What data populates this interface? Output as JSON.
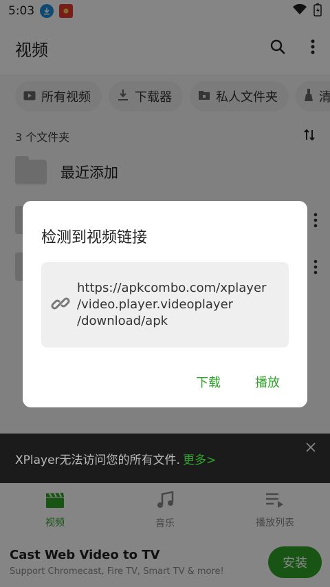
{
  "status_bar": {
    "time": "5:03",
    "icons": [
      "download-notification-icon",
      "app-notification-icon",
      "wifi-icon",
      "battery-charging-icon"
    ]
  },
  "app_bar": {
    "title": "视频",
    "actions": [
      "search-icon",
      "more-vert-icon"
    ]
  },
  "chips": [
    {
      "label": "所有视频",
      "icon": "video-icon"
    },
    {
      "label": "下载器",
      "icon": "download-icon"
    },
    {
      "label": "私人文件夹",
      "icon": "lock-folder-icon"
    },
    {
      "label": "清理",
      "icon": "broom-icon"
    }
  ],
  "folders": {
    "count_label": "3 个文件夹",
    "items": [
      {
        "label": "最近添加"
      }
    ]
  },
  "dialog": {
    "title": "检测到视频链接",
    "url": "https://apkcombo.com/xplayer/video.player.videoplayer/download/apk",
    "url_lines": [
      "https://apkcombo.com/xplayer",
      "/video.player.videoplayer",
      "/download/apk"
    ],
    "actions": {
      "download": "下载",
      "play": "播放"
    }
  },
  "snackbar": {
    "text": "XPlayer无法访问您的所有文件.",
    "more": "更多>"
  },
  "bottom_nav": {
    "items": [
      {
        "label": "视频",
        "active": true
      },
      {
        "label": "音乐",
        "active": false
      },
      {
        "label": "播放列表",
        "active": false
      }
    ]
  },
  "ad": {
    "title": "Cast Web Video to TV",
    "subtitle": "Support Chromecast, Fire TV, Smart TV & more!",
    "button": "安装"
  },
  "colors": {
    "accent": "#2ea42a",
    "dialog_bg": "#ffffff",
    "scrim": "#000000"
  }
}
